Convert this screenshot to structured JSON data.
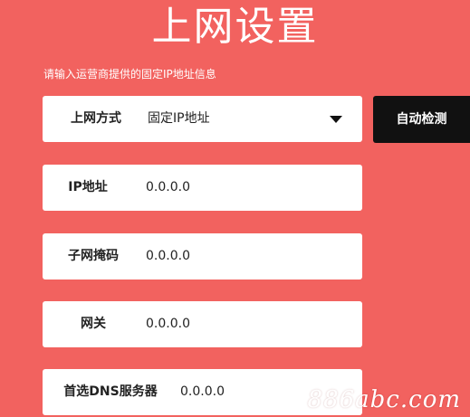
{
  "page": {
    "title": "上网设置",
    "subtitle": "请输入运营商提供的固定IP地址信息"
  },
  "form": {
    "connection_type": {
      "label": "上网方式",
      "value": "固定IP地址"
    },
    "ip_address": {
      "label": "IP地址",
      "value": "0.0.0.0"
    },
    "subnet_mask": {
      "label": "子网掩码",
      "value": "0.0.0.0"
    },
    "gateway": {
      "label": "网关",
      "value": "0.0.0.0"
    },
    "primary_dns": {
      "label": "首选DNS服务器",
      "value": "0.0.0.0"
    }
  },
  "buttons": {
    "auto_detect": "自动检测"
  },
  "watermark": "886abc.com",
  "colors": {
    "background": "#f2625f",
    "field": "#ffffff",
    "button": "#111111"
  },
  "icons": {
    "dropdown": "caret-down-icon"
  }
}
